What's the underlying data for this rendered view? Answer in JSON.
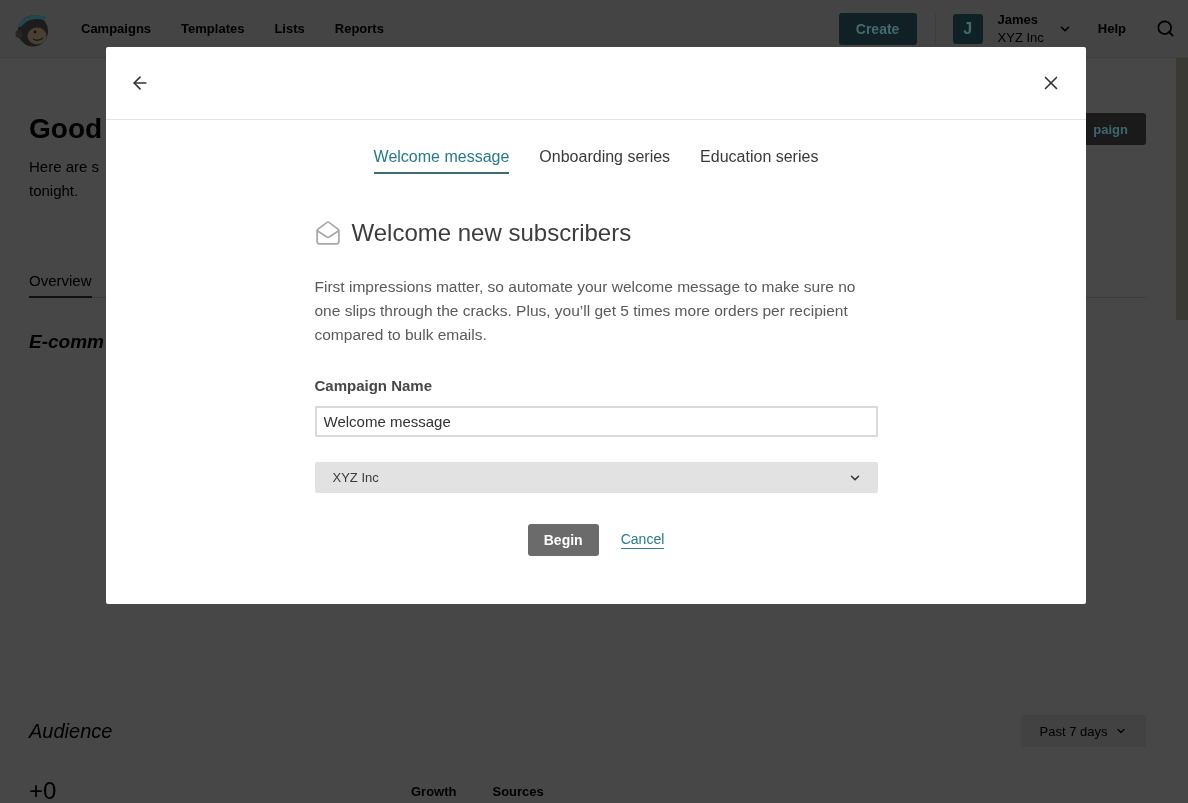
{
  "top_nav": {
    "links": [
      {
        "label": "Campaigns"
      },
      {
        "label": "Templates"
      },
      {
        "label": "Lists"
      },
      {
        "label": "Reports"
      }
    ],
    "create_button": "Create",
    "account": {
      "initial": "J",
      "name": "James",
      "organization": "XYZ Inc"
    },
    "help_link": "Help"
  },
  "dashboard": {
    "greeting": "Good",
    "intro_lines": [
      "Here are s",
      "tonight."
    ],
    "action_button": "paign",
    "tabs": [
      {
        "label": "Overview",
        "selected": true
      }
    ],
    "section_title": "E-comm",
    "audience": {
      "title": "Audience",
      "period_button": "Past 7 days",
      "stat": "+0",
      "chart_tabs": [
        {
          "label": "Growth"
        },
        {
          "label": "Sources"
        }
      ]
    }
  },
  "dialog": {
    "tabs": [
      {
        "label": "Welcome message",
        "selected": true
      },
      {
        "label": "Onboarding series",
        "selected": false
      },
      {
        "label": "Education series",
        "selected": false
      }
    ],
    "title": "Welcome new subscribers",
    "description": "First impressions matter, so automate your welcome message to make sure no one slips through the cracks. Plus, you’ll get 5 times more orders per recipient compared to bulk emails.",
    "field": {
      "label": "Campaign Name",
      "value": "Welcome message"
    },
    "account_select": {
      "value": "XYZ Inc"
    },
    "primary_button": "Begin",
    "cancel_link": "Cancel"
  }
}
